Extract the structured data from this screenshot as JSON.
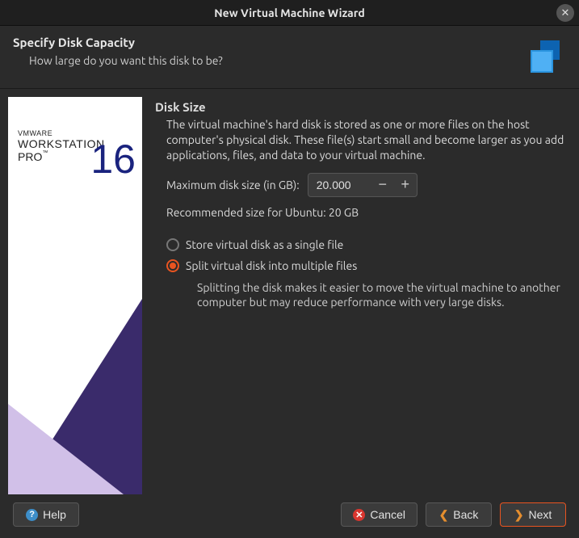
{
  "window": {
    "title": "New Virtual Machine Wizard"
  },
  "header": {
    "title": "Specify Disk Capacity",
    "subtitle": "How large do you want this disk to be?"
  },
  "sidebar": {
    "brand_small": "VMWARE",
    "brand_main": "WORKSTATION",
    "brand_sub": "PRO",
    "brand_tm": "™",
    "version": "16"
  },
  "content": {
    "section_title": "Disk Size",
    "description": "The virtual machine's hard disk is stored as one or more files on the host computer's physical disk. These file(s) start small and become larger as you add applications, files, and data to your virtual machine.",
    "max_size_label": "Maximum disk size (in GB):",
    "max_size_value": "20.000",
    "recommended": "Recommended size for Ubuntu: 20 GB",
    "radio": {
      "options": [
        {
          "label": "Store virtual disk as a single file",
          "selected": false
        },
        {
          "label": "Split virtual disk into multiple files",
          "selected": true
        }
      ],
      "split_sub": "Splitting the disk makes it easier to move the virtual machine to another computer but may reduce performance with very large disks."
    }
  },
  "footer": {
    "help": "Help",
    "cancel": "Cancel",
    "back": "Back",
    "next": "Next"
  }
}
